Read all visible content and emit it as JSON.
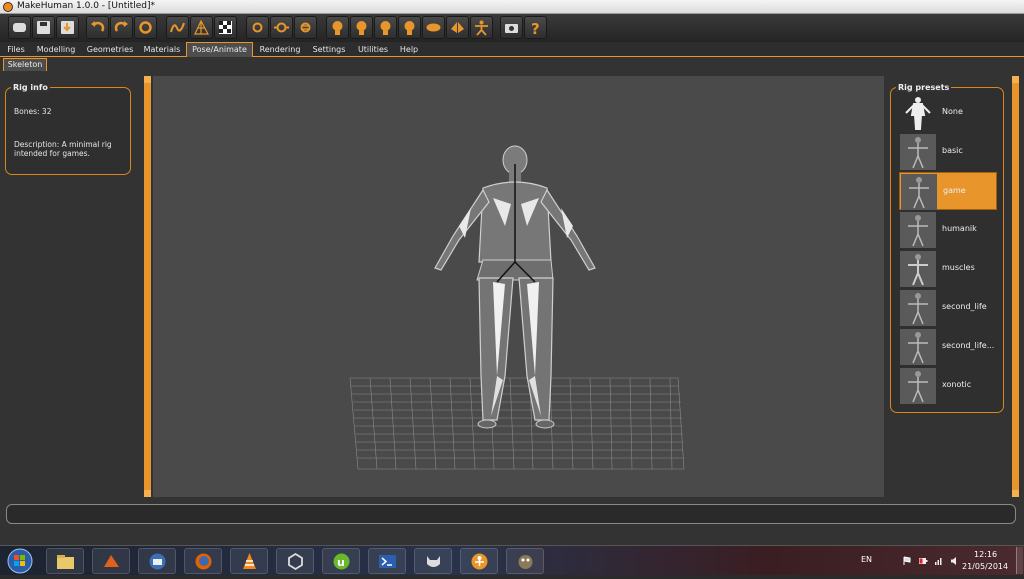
{
  "window": {
    "title": "MakeHuman 1.0.0 - [Untitled]*"
  },
  "toolbar": {
    "icons": [
      "new-icon",
      "save-icon",
      "export-icon",
      "undo-icon",
      "redo-icon",
      "reset-icon",
      "smooth-icon",
      "wireframe-icon",
      "background-icon",
      "pose-icon",
      "front-view-icon",
      "side-view-icon",
      "back-view-icon",
      "top-view-icon",
      "left-view-icon",
      "right-view-icon",
      "reset-camera-icon",
      "symmetry-left-icon",
      "symmetry-right-icon",
      "screenshot-icon",
      "help-icon"
    ]
  },
  "tabs": [
    "Files",
    "Modelling",
    "Geometries",
    "Materials",
    "Pose/Animate",
    "Rendering",
    "Settings",
    "Utilities",
    "Help"
  ],
  "active_tab": "Pose/Animate",
  "subtab": "Skeleton",
  "rig_info": {
    "title": "Rig info",
    "bones": "Bones: 32",
    "description_line1": "Description: A minimal rig",
    "description_line2": "intended for games."
  },
  "rig_presets": {
    "title": "Rig presets",
    "items": [
      {
        "label": "None",
        "selected": false
      },
      {
        "label": "basic",
        "selected": false
      },
      {
        "label": "game",
        "selected": true
      },
      {
        "label": "humanik",
        "selected": false
      },
      {
        "label": "muscles",
        "selected": false
      },
      {
        "label": "second_life",
        "selected": false
      },
      {
        "label": "second_life...",
        "selected": false
      },
      {
        "label": "xonotic",
        "selected": false
      }
    ]
  },
  "taskbar": {
    "language": "EN",
    "time": "12:16",
    "date": "21/05/2014"
  },
  "colors": {
    "accent": "#e8962b",
    "viewport": "#4a4a4a",
    "panel": "#333333"
  }
}
